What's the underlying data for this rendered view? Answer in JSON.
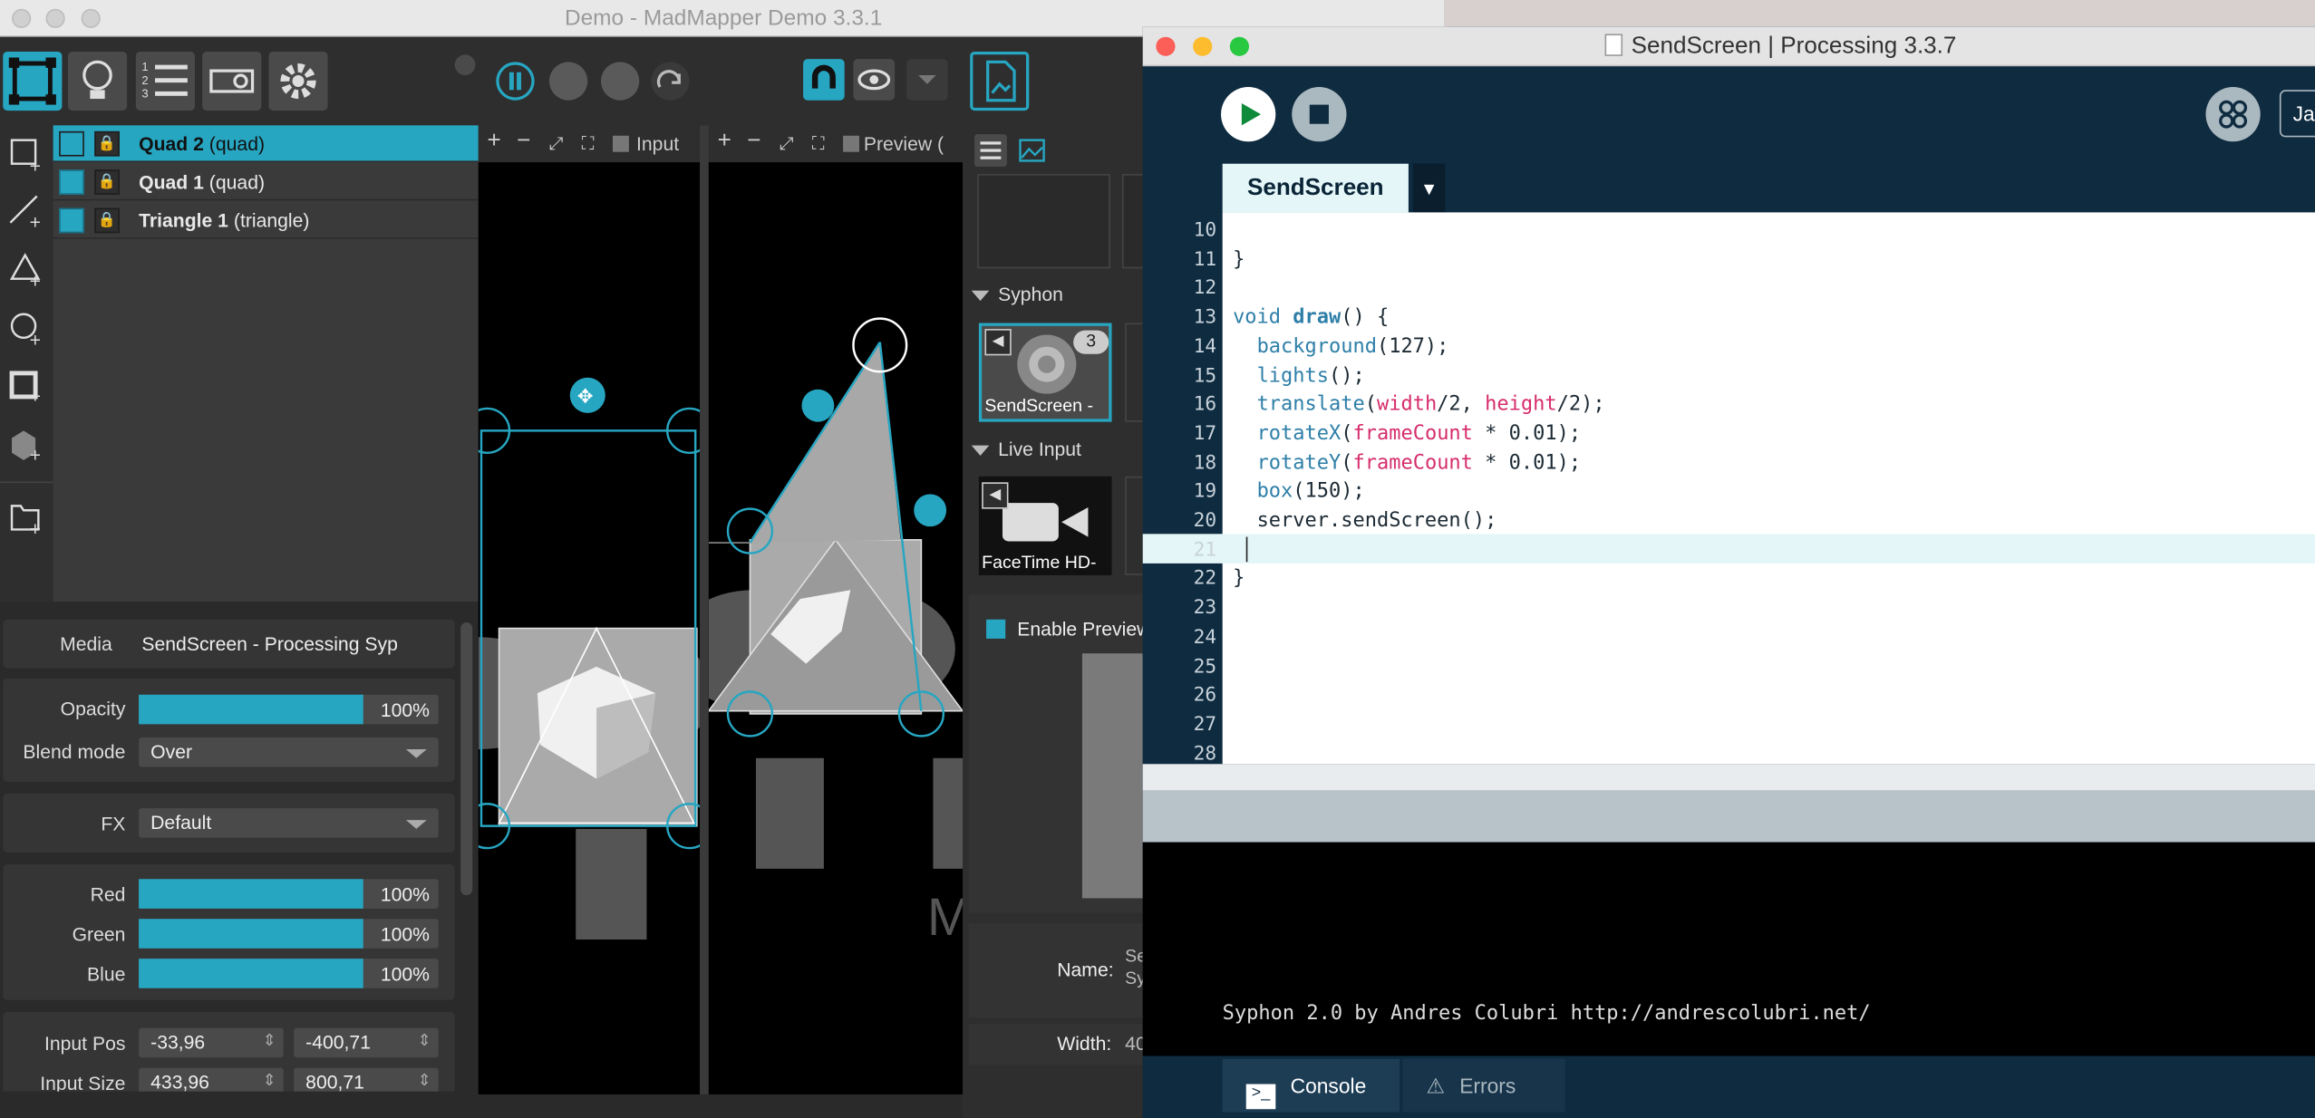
{
  "madmapper": {
    "title": "Demo - MadMapper Demo 3.3.1",
    "surfaces": [
      {
        "name": "Quad 2",
        "type": "(quad)",
        "selected": true
      },
      {
        "name": "Quad 1",
        "type": "(quad)",
        "selected": false
      },
      {
        "name": "Triangle 1",
        "type": "(triangle)",
        "selected": false
      }
    ],
    "viewports": {
      "input": "Input",
      "preview": "Preview ("
    },
    "props": {
      "media_label": "Media",
      "media_value": "SendScreen - Processing Syp",
      "opacity_label": "Opacity",
      "opacity_value": "100%",
      "blend_label": "Blend mode",
      "blend_value": "Over",
      "fx_label": "FX",
      "fx_value": "Default",
      "red_label": "Red",
      "red_value": "100%",
      "green_label": "Green",
      "green_value": "100%",
      "blue_label": "Blue",
      "blue_value": "100%",
      "input_pos_label": "Input Pos",
      "input_pos_x": "-33,96",
      "input_pos_y": "-400,71",
      "input_size_label": "Input Size",
      "input_size_x": "433,96",
      "input_size_y": "800,71"
    },
    "levels": {
      "opacity": 1.0,
      "red": 1.0,
      "green": 1.0,
      "blue": 1.0
    },
    "media": {
      "syphon_label": "Syphon",
      "syphon_item": "SendScreen -",
      "syphon_badge": "3",
      "live_label": "Live Input",
      "live_item": "FaceTime HD-",
      "enable_preview": "Enable Preview",
      "name_label": "Name:",
      "name_value_1": "Se",
      "name_value_2": "Sy",
      "width_label": "Width:",
      "width_value": "40"
    },
    "watermark": "M",
    "accent": "#27a6c2"
  },
  "processing": {
    "title": "SendScreen | Processing 3.3.7",
    "tab": "SendScreen",
    "mode": "Ja",
    "line_numbers": [
      "10",
      "11",
      "12",
      "13",
      "14",
      "15",
      "16",
      "17",
      "18",
      "19",
      "20",
      "21",
      "22",
      "23",
      "24",
      "25",
      "26",
      "27",
      "28"
    ],
    "code": {
      "l11": "}",
      "l13_kw": "void",
      "l13_fn": "draw",
      "l13_rest": "() {",
      "l14_fn": "background",
      "l14_rest": "(127);",
      "l15_fn": "lights",
      "l15_rest": "();",
      "l16_fn": "translate",
      "l16_p1": "(",
      "l16_c1": "width",
      "l16_p2": "/2, ",
      "l16_c2": "height",
      "l16_p3": "/2);",
      "l17_fn": "rotateX",
      "l17_p1": "(",
      "l17_c1": "frameCount",
      "l17_p2": " * 0.01);",
      "l18_fn": "rotateY",
      "l18_p1": "(",
      "l18_c1": "frameCount",
      "l18_p2": " * 0.01);",
      "l19_fn": "box",
      "l19_rest": "(150);",
      "l20": "server.sendScreen();",
      "l22": "}"
    },
    "console_text": "Syphon 2.0 by Andres Colubri http://andrescolubri.net/",
    "console_tab": "Console",
    "errors_tab": "Errors"
  }
}
